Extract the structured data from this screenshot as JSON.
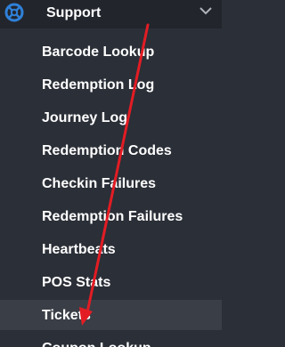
{
  "section": {
    "title": "Support",
    "icon": "support-lifebuoy-icon",
    "expanded": true
  },
  "items": [
    {
      "label": "Barcode Lookup"
    },
    {
      "label": "Redemption Log"
    },
    {
      "label": "Journey Log"
    },
    {
      "label": "Redemption Codes"
    },
    {
      "label": "Checkin Failures"
    },
    {
      "label": "Redemption Failures"
    },
    {
      "label": "Heartbeats"
    },
    {
      "label": "POS Stats"
    },
    {
      "label": "Tickets"
    },
    {
      "label": "Coupon Lookup"
    }
  ],
  "highlighted_item": "Tickets",
  "colors": {
    "background": "#2b2f37",
    "header_background": "#22252c",
    "active_background": "#3a3e46",
    "text": "#ffffff",
    "accent_icon": "#2f80d8",
    "annotation_arrow": "#e31c24"
  }
}
